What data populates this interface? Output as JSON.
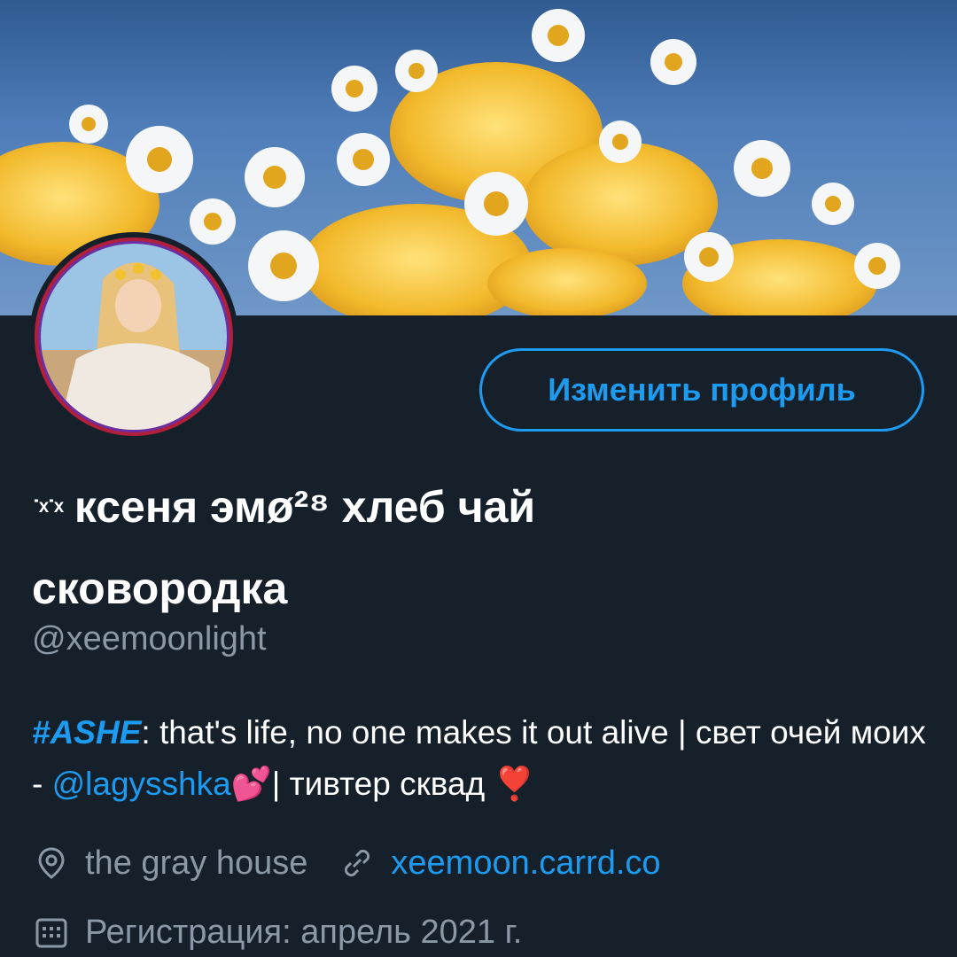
{
  "profile": {
    "display_name_line1": "ксеня эмø²⁸ хлеб чай",
    "display_name_line2": "сковородка",
    "display_name_kaomoji": "˙ˣ˙ˣ",
    "username": "@xeemoonlight",
    "edit_button_label": "Изменить профиль",
    "bio": {
      "hashtag": "#ASHE",
      "text1": ": that's life, no one makes it out alive | свет очей моих - ",
      "mention": "@lagysshka",
      "emoji_hearts": "💕",
      "text2": "| тивтер сквад ",
      "emoji_heart": "❣️"
    },
    "location": "the gray house",
    "website": "xeemoon.carrd.co",
    "joined": "Регистрация: апрель 2021 г."
  },
  "icons": {
    "location": "location-pin-icon",
    "link": "link-icon",
    "calendar": "calendar-icon"
  },
  "colors": {
    "background": "#15202b",
    "accent": "#1d9bf0",
    "secondary_text": "#8b98a5"
  }
}
